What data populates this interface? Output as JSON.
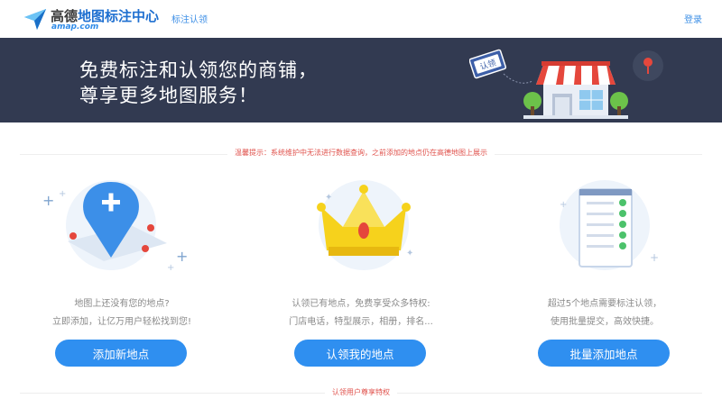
{
  "header": {
    "logo_cn_main": "高德",
    "logo_cn_sub": "地图标注中心",
    "logo_en": "amap.com",
    "nav_label": "标注认领",
    "login_label": "登录"
  },
  "banner": {
    "title_line1": "免费标注和认领您的商铺，",
    "title_line2": "尊享更多地图服务！",
    "badge_text": "认领"
  },
  "notice": {
    "text": "温馨提示：系统维护中无法进行数据查询，之前添加的地点仍在高德地图上展示"
  },
  "columns": [
    {
      "illustration": "map-pin-plus-illustration",
      "lines": [
        "地图上还没有您的地点?",
        "立即添加，让亿万用户轻松找到您!"
      ],
      "button": "添加新地点"
    },
    {
      "illustration": "crown-illustration",
      "lines": [
        "认领已有地点，免费享受众多特权:",
        "门店电话，特型展示，相册，排名..."
      ],
      "button": "认领我的地点"
    },
    {
      "illustration": "checklist-illustration",
      "lines": [
        "超过5个地点需要标注认领，",
        "使用批量提交，高效快捷。"
      ],
      "button": "批量添加地点"
    }
  ],
  "footer": {
    "section_label": "认领用户尊享特权"
  },
  "colors": {
    "accent": "#2f8ff0",
    "banner_bg": "#323a51",
    "notice_red": "#e0524c"
  }
}
